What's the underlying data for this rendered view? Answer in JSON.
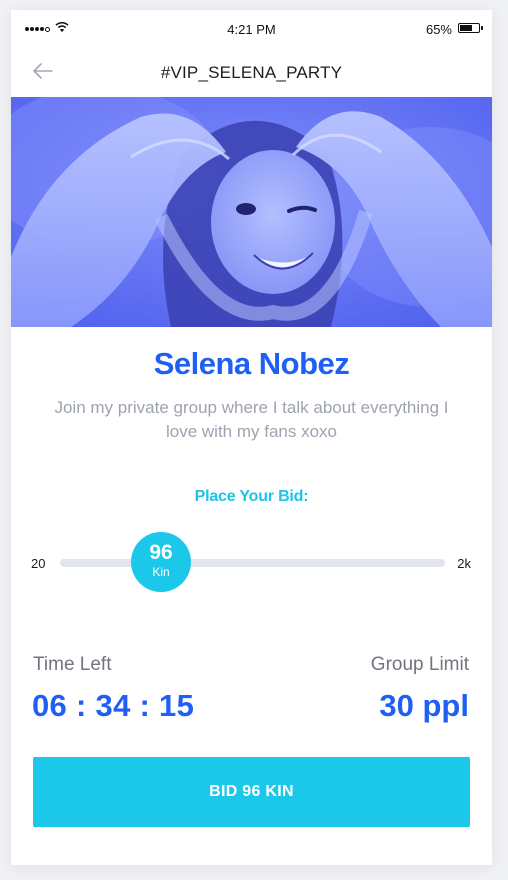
{
  "status_bar": {
    "time": "4:21 PM",
    "battery_percent": "65%",
    "battery_level": 0.65,
    "signal_bars_filled": 4,
    "signal_bars_total": 5
  },
  "nav": {
    "title": "#VIP_SELENA_PARTY",
    "back_icon": "arrow-left-icon"
  },
  "profile": {
    "name": "Selena Nobez",
    "bio": "Join my private group where I talk about everything I love with my fans xoxo"
  },
  "bid": {
    "heading": "Place Your Bid:",
    "min_label": "20",
    "max_label": "2k",
    "current_value": "96",
    "current_unit": "Kin",
    "button_label": "BID 96 KIN"
  },
  "stats": {
    "time_left_label": "Time Left",
    "time_left_value": "06 : 34 : 15",
    "group_limit_label": "Group Limit",
    "group_limit_value": "30 ppl"
  },
  "colors": {
    "accent_blue": "#1f5ff6",
    "accent_cyan": "#1cc8ea",
    "hero_tint": "#5a6bf2",
    "muted_text": "#9ea3b0"
  }
}
